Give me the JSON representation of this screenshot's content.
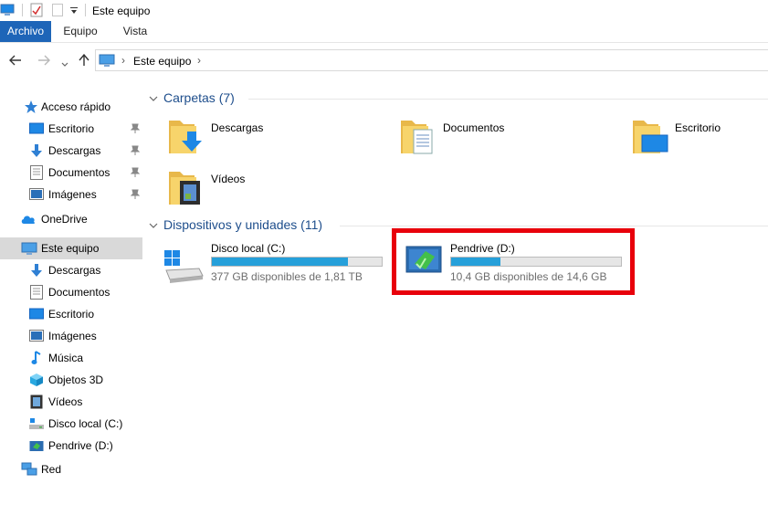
{
  "window": {
    "title": "Este equipo"
  },
  "ribbon": {
    "tabs": [
      "Archivo",
      "Equipo",
      "Vista"
    ]
  },
  "address": {
    "location": "Este equipo"
  },
  "sidebar": {
    "quick_access": {
      "label": "Acceso rápido",
      "items": [
        {
          "label": "Escritorio",
          "icon": "desktop-icon",
          "pinned": true
        },
        {
          "label": "Descargas",
          "icon": "download-arrow-icon",
          "pinned": true
        },
        {
          "label": "Documentos",
          "icon": "document-icon",
          "pinned": true
        },
        {
          "label": "Imágenes",
          "icon": "pictures-icon",
          "pinned": true
        }
      ]
    },
    "onedrive": {
      "label": "OneDrive"
    },
    "this_pc": {
      "label": "Este equipo",
      "items": [
        {
          "label": "Descargas",
          "icon": "download-arrow-icon"
        },
        {
          "label": "Documentos",
          "icon": "document-icon"
        },
        {
          "label": "Escritorio",
          "icon": "desktop-icon"
        },
        {
          "label": "Imágenes",
          "icon": "pictures-icon"
        },
        {
          "label": "Música",
          "icon": "music-note-icon"
        },
        {
          "label": "Objetos 3D",
          "icon": "cube-3d-icon"
        },
        {
          "label": "Vídeos",
          "icon": "video-film-icon"
        },
        {
          "label": "Disco local (C:)",
          "icon": "local-disk-icon"
        },
        {
          "label": "Pendrive (D:)",
          "icon": "usb-drive-icon"
        }
      ]
    },
    "network": {
      "label": "Red"
    }
  },
  "content": {
    "folders_header": "Carpetas (7)",
    "folders": [
      {
        "label": "Descargas",
        "icon": "downloads-folder-icon"
      },
      {
        "label": "Documentos",
        "icon": "documents-folder-icon"
      },
      {
        "label": "Escritorio",
        "icon": "desktop-folder-icon"
      },
      {
        "label": "Vídeos",
        "icon": "videos-folder-icon"
      }
    ],
    "devices_header": "Dispositivos y unidades (11)",
    "devices": [
      {
        "label": "Disco local (C:)",
        "free_text": "377 GB disponibles de 1,81 TB",
        "used_fraction": 0.8,
        "icon": "windows-drive-icon"
      },
      {
        "label": "Pendrive (D:)",
        "free_text": "10,4 GB disponibles de 14,6 GB",
        "used_fraction": 0.29,
        "icon": "usb-drive-icon",
        "highlighted": true
      }
    ]
  },
  "colors": {
    "accent": "#1e65b8",
    "bar_fill": "#26a0da",
    "highlight": "#e8000b",
    "header_blue": "#1e4e8c",
    "selection": "#d9d9d9"
  }
}
